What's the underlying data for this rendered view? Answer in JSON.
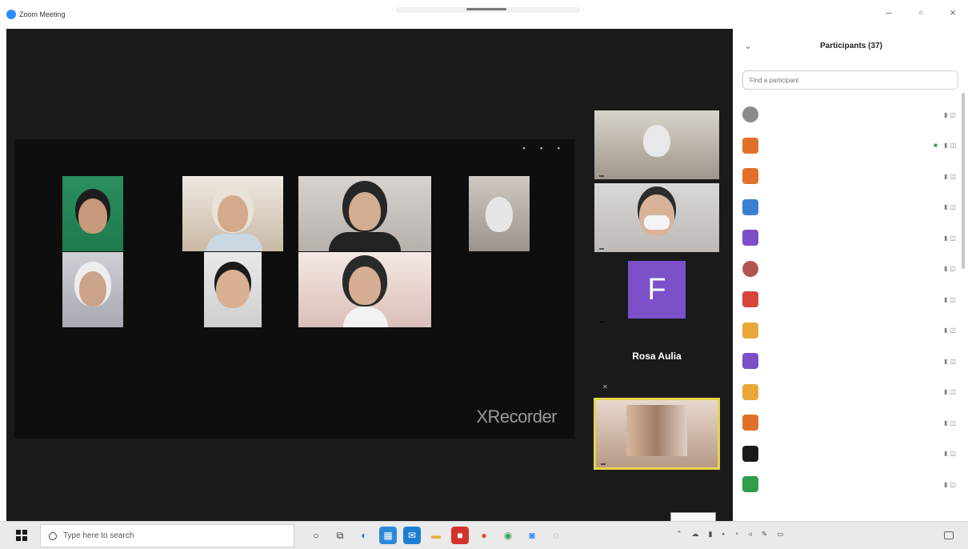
{
  "window": {
    "title": "Zoom Meeting"
  },
  "video": {
    "watermark": "XRecorder",
    "side_tiles": [
      {
        "name": ""
      },
      {
        "name": ""
      },
      {
        "letter": "F",
        "name": ""
      },
      {
        "name": "Rosa Aulia"
      },
      {
        "name": ""
      }
    ]
  },
  "panel": {
    "title": "Participants (37)",
    "search_placeholder": "Find a participant",
    "participants": [
      {
        "initials": "",
        "color": "#8a8a8a",
        "name": ""
      },
      {
        "initials": "",
        "color": "#e1712a",
        "name": ""
      },
      {
        "initials": "",
        "color": "#e1712a",
        "name": ""
      },
      {
        "initials": "",
        "color": "#3b7fd4",
        "name": ""
      },
      {
        "initials": "",
        "color": "#7c4fc9",
        "name": ""
      },
      {
        "initials": "",
        "color": "#b3554f",
        "name": ""
      },
      {
        "initials": "",
        "color": "#d6453c",
        "name": ""
      },
      {
        "initials": "",
        "color": "#e9a93a",
        "name": ""
      },
      {
        "initials": "",
        "color": "#7c4fc9",
        "name": ""
      },
      {
        "initials": "",
        "color": "#e9a93a",
        "name": ""
      },
      {
        "initials": "",
        "color": "#e1712a",
        "name": ""
      },
      {
        "initials": "",
        "color": "#1a1a1a",
        "name": ""
      },
      {
        "initials": "",
        "color": "#2e9d4c",
        "name": ""
      }
    ]
  },
  "taskbar": {
    "search_text": "Type here to search",
    "time": "",
    "date": ""
  },
  "colors": {
    "accent": "#2d8cff",
    "active_border": "#e6d34a"
  }
}
